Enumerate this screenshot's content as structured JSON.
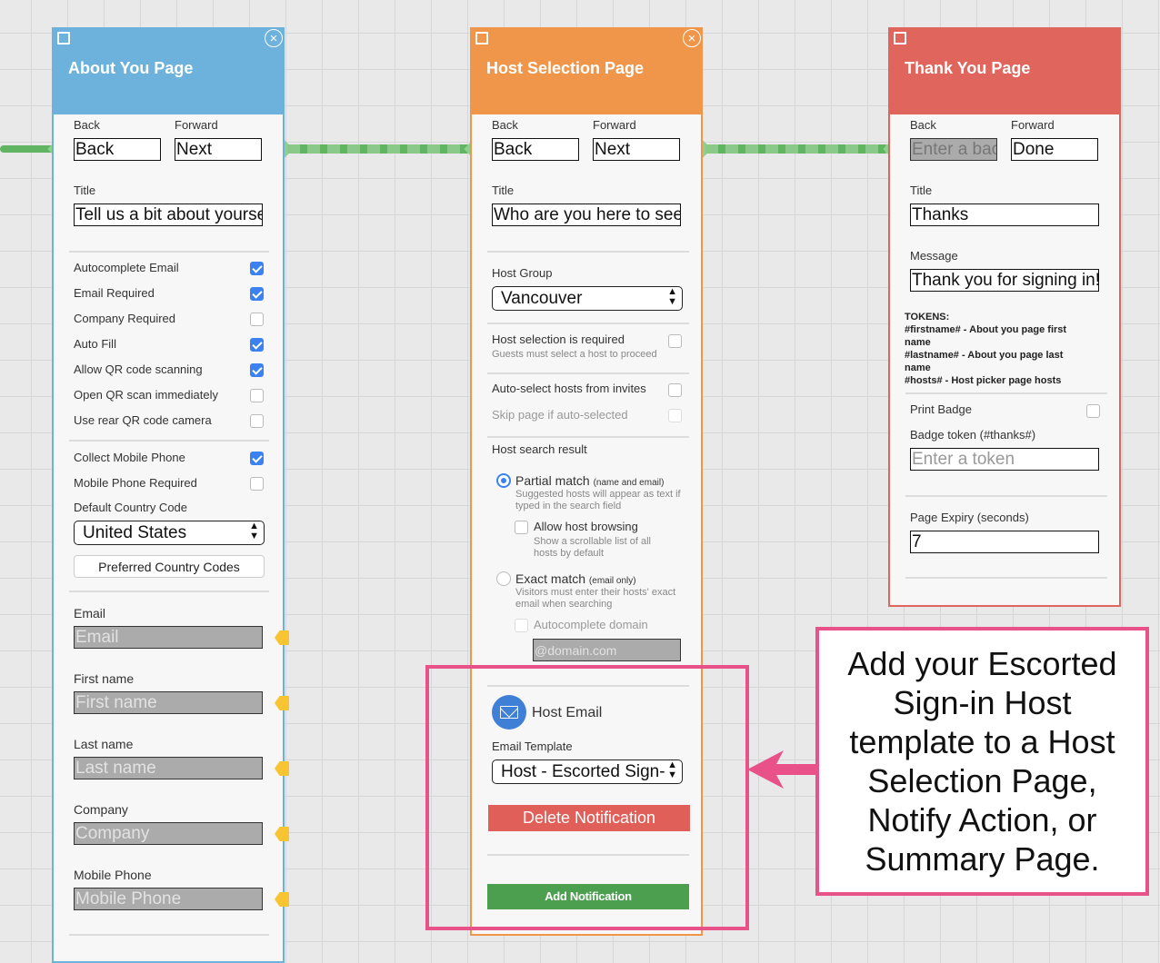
{
  "about_page": {
    "title": "About You Page",
    "back_label": "Back",
    "forward_label": "Forward",
    "back_value": "Back",
    "forward_value": "Next",
    "title_label": "Title",
    "title_value": "Tell us a bit about yourse",
    "options": [
      {
        "label": "Autocomplete Email",
        "checked": true
      },
      {
        "label": "Email Required",
        "checked": true
      },
      {
        "label": "Company Required",
        "checked": false
      },
      {
        "label": "Auto Fill",
        "checked": true
      },
      {
        "label": "Allow QR code scanning",
        "checked": true
      },
      {
        "label": "Open QR scan immediately",
        "checked": false
      },
      {
        "label": "Use rear QR code camera",
        "checked": false
      }
    ],
    "collect_mobile_label": "Collect Mobile Phone",
    "mobile_required_label": "Mobile Phone Required",
    "country_code_label": "Default Country Code",
    "country_value": "United States",
    "preferred_codes_button": "Preferred Country Codes",
    "fields": [
      {
        "label": "Email",
        "placeholder": "Email"
      },
      {
        "label": "First name",
        "placeholder": "First name"
      },
      {
        "label": "Last name",
        "placeholder": "Last name"
      },
      {
        "label": "Company",
        "placeholder": "Company"
      },
      {
        "label": "Mobile Phone",
        "placeholder": "Mobile Phone"
      }
    ]
  },
  "host_page": {
    "title": "Host Selection Page",
    "back_label": "Back",
    "forward_label": "Forward",
    "back_value": "Back",
    "forward_value": "Next",
    "title_label": "Title",
    "title_value": "Who are you here to see",
    "host_group_label": "Host Group",
    "host_group_value": "Vancouver",
    "host_required_label": "Host selection is required",
    "host_required_sub": "Guests must select a host to proceed",
    "auto_select_label": "Auto-select hosts from invites",
    "skip_page_label": "Skip page if auto-selected",
    "search_result_label": "Host search result",
    "partial_match_label": "Partial match",
    "partial_match_note": "(name and email)",
    "partial_match_sub": "Suggested hosts will appear as text if typed in the search field",
    "allow_browsing_label": "Allow host browsing",
    "allow_browsing_sub": "Show a scrollable list of all hosts by default",
    "exact_match_label": "Exact match",
    "exact_match_note": "(email only)",
    "exact_match_sub": "Visitors must enter their hosts' exact email when searching",
    "autocomplete_domain_label": "Autocomplete domain",
    "domain_placeholder": "@domain.com",
    "host_email_label": "Host Email",
    "email_template_label": "Email Template",
    "email_template_value": "Host - Escorted Sign-",
    "delete_button": "Delete Notification",
    "add_button": "Add Notification"
  },
  "thanks_page": {
    "title": "Thank You Page",
    "back_label": "Back",
    "forward_label": "Forward",
    "back_placeholder": "Enter a bac",
    "forward_value": "Done",
    "title_label": "Title",
    "title_value": "Thanks",
    "message_label": "Message",
    "message_value": "Thank you for signing in!",
    "tokens_heading": "TOKENS:",
    "token_lines": [
      "#firstname# - About you page first",
      "name",
      "#lastname# - About you page last",
      "name",
      "#hosts# - Host picker page hosts"
    ],
    "print_badge_label": "Print Badge",
    "badge_token_label": "Badge token (#thanks#)",
    "badge_token_placeholder": "Enter a token",
    "expiry_label": "Page Expiry (seconds)",
    "expiry_value": "7"
  },
  "callout": {
    "text": "Add your Escorted Sign-in Host template to a Host Selection Page, Notify Action, or Summary Page."
  },
  "colors": {
    "about_header": "#6db2dc",
    "host_header": "#f0964b",
    "thanks_header": "#e0655c",
    "highlight": "#e85288",
    "connector": "#61b562",
    "checkbox_on": "#3b82f0"
  }
}
